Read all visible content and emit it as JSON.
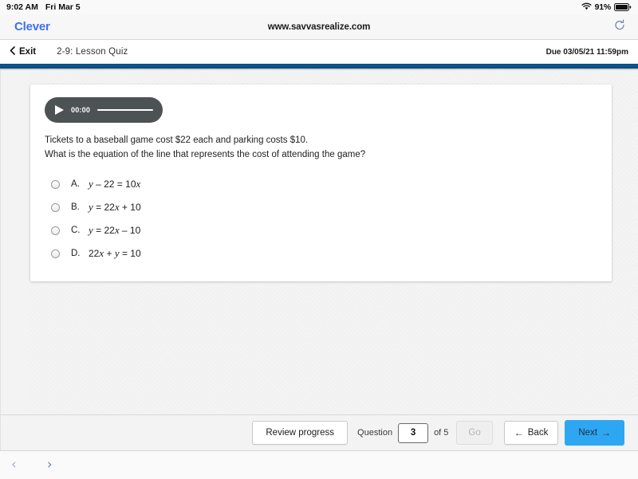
{
  "status_bar": {
    "time": "9:02 AM",
    "date": "Fri Mar 5",
    "battery_percent": "91%",
    "wifi_icon": "wifi-icon",
    "battery_icon": "battery-icon"
  },
  "browser": {
    "logo": "Clever",
    "url": "www.savvasrealize.com",
    "reload_icon": "reload-icon",
    "back_icon": "chevron-left-icon",
    "forward_icon": "chevron-right-icon"
  },
  "app_header": {
    "exit_label": "Exit",
    "exit_icon": "chevron-left-icon",
    "quiz_title": "2-9: Lesson Quiz",
    "due_text": "Due 03/05/21 11:59pm"
  },
  "audio": {
    "play_icon": "play-icon",
    "time": "00:00"
  },
  "question": {
    "line1": "Tickets to a baseball game cost $22 each and parking costs $10.",
    "line2": "What is the equation of the line that represents the cost of attending the game?",
    "options": [
      {
        "letter": "A.",
        "prefix": "",
        "var1": "y",
        "mid": " – 22 = 10",
        "var2": "x",
        "suffix": ""
      },
      {
        "letter": "B.",
        "prefix": "",
        "var1": "y",
        "mid": " = 22",
        "var2": "x",
        "suffix": " + 10"
      },
      {
        "letter": "C.",
        "prefix": "",
        "var1": "y",
        "mid": " = 22",
        "var2": "x",
        "suffix": " – 10"
      },
      {
        "letter": "D.",
        "prefix": "22",
        "var1": "x",
        "mid": " + ",
        "var2": "y",
        "suffix": " = 10"
      }
    ]
  },
  "footer": {
    "review_label": "Review progress",
    "question_label": "Question",
    "question_value": "3",
    "of_label": "of 5",
    "go_label": "Go",
    "back_label": "Back",
    "back_arrow": "←",
    "next_label": "Next",
    "next_arrow": "→"
  },
  "colors": {
    "clever_blue": "#3e6ff1",
    "navy_bar": "#0f5891",
    "next_button": "#2ea7f2",
    "audio_pill": "#4d5254"
  }
}
